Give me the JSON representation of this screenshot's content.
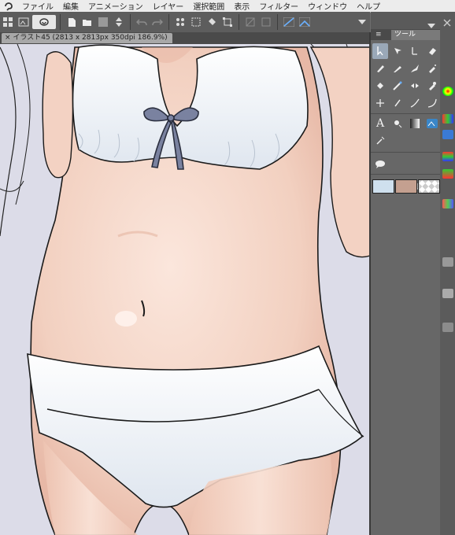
{
  "menubar": {
    "logo_icon": "clip-studio-logo-icon",
    "items": [
      "ファイル",
      "編集",
      "アニメーション",
      "レイヤー",
      "選択範囲",
      "表示",
      "フィルター",
      "ウィンドウ",
      "ヘルプ"
    ]
  },
  "document_tab": {
    "close": "×",
    "title": "イラスト45 (2813 x 2813px 350dpi 186.9%)"
  },
  "tool_panel": {
    "tab_label": "ツール"
  },
  "colors": {
    "main_color": "#cfe0ee",
    "sub_color": "#c4a090",
    "canvas_bg": "#dcdce8",
    "skin": "#f4d7c9",
    "bra_ribbon": "#5a6078"
  }
}
